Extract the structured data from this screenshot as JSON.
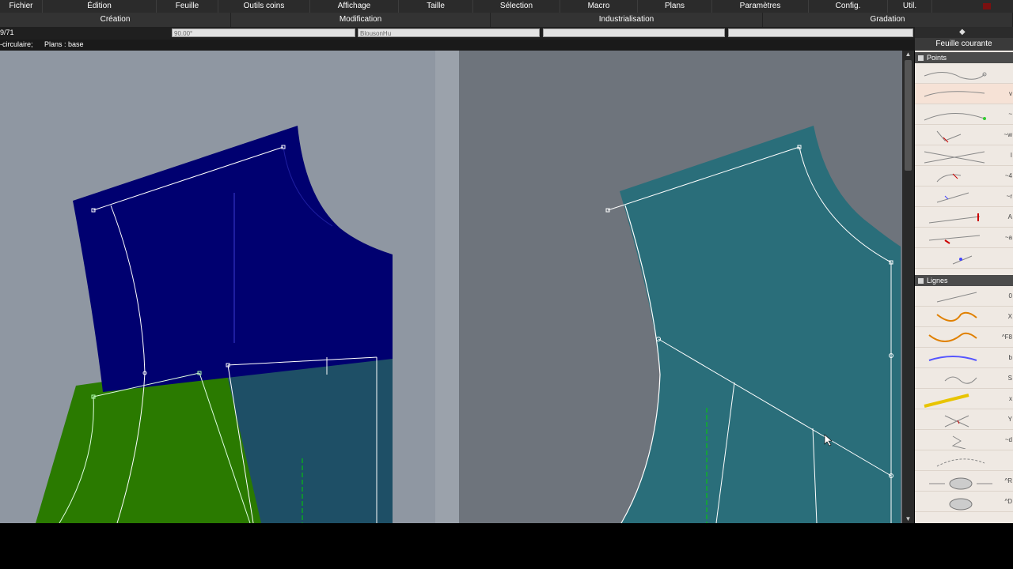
{
  "menu": [
    "Fichier",
    "Édition",
    "Feuille",
    "Outils coins",
    "Affichage",
    "Taille",
    "Sélection",
    "Macro",
    "Plans",
    "Paramètres",
    "Config.",
    "Util."
  ],
  "modes": [
    "Création",
    "Modification",
    "Industrialisation",
    "Gradation"
  ],
  "fields": {
    "counter": "9/71",
    "angle": "90.00°",
    "model_name": "BlousonHu",
    "empty1": "",
    "empty2": ""
  },
  "status": {
    "mode": "-circulaire;",
    "plans": "Plans :  base"
  },
  "panel": {
    "title": "Feuille courante",
    "sections": {
      "points": "Points",
      "lignes": "Lignes"
    },
    "point_tools": [
      {
        "name": "point-curve-tool",
        "shortcut": ""
      },
      {
        "name": "point-on-line-tool",
        "shortcut": "v"
      },
      {
        "name": "point-multi-tool",
        "shortcut": "~"
      },
      {
        "name": "point-check-tool",
        "shortcut": "~w"
      },
      {
        "name": "point-intersection-tool",
        "shortcut": "I"
      },
      {
        "name": "point-arrow-tool",
        "shortcut": "~4"
      },
      {
        "name": "point-angle-tool",
        "shortcut": "~r"
      },
      {
        "name": "point-red-tool",
        "shortcut": "A"
      },
      {
        "name": "point-offset-tool",
        "shortcut": "~a"
      },
      {
        "name": "point-cluster-tool",
        "shortcut": ""
      }
    ],
    "line_tools": [
      {
        "name": "line-straight-tool",
        "shortcut": "0"
      },
      {
        "name": "line-orange-curve-tool",
        "shortcut": "X"
      },
      {
        "name": "line-orange-double-tool",
        "shortcut": "^F8"
      },
      {
        "name": "line-blue-curve-tool",
        "shortcut": "b"
      },
      {
        "name": "line-loop-tool",
        "shortcut": "S"
      },
      {
        "name": "line-yellow-pencil-tool",
        "shortcut": "x"
      },
      {
        "name": "line-cross-tool",
        "shortcut": "Y"
      },
      {
        "name": "line-zigzag-tool",
        "shortcut": "~d"
      },
      {
        "name": "line-dotted-curve-tool",
        "shortcut": ""
      },
      {
        "name": "line-mouse-arrows-tool",
        "shortcut": "^R"
      },
      {
        "name": "line-mouse-tool",
        "shortcut": "^D"
      }
    ]
  },
  "colors": {
    "navy_piece": "#000070",
    "green_piece": "#2a7a00",
    "teal_piece": "#2a6e7a",
    "dark_teal_piece": "#1e4f66",
    "left_bg": "#8f97a2",
    "right_bg": "#6e747c"
  }
}
